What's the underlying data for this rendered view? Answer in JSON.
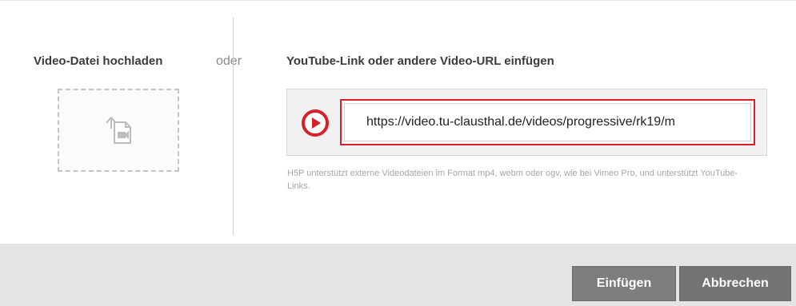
{
  "upload": {
    "label": "Video-Datei hochladen",
    "icon": "upload-video-icon"
  },
  "separator": {
    "label": "oder"
  },
  "url": {
    "label": "YouTube-Link oder andere Video-URL einfügen",
    "value": "https://video.tu-clausthal.de/videos/progressive/rk19/m",
    "play_icon": "play-icon",
    "help_text": "H5P unterstützt externe Videodateien im Format mp4, webm oder ogv, wie bei Vimeo Pro, und unterstützt YouTube-Links."
  },
  "footer": {
    "insert_label": "Einfügen",
    "cancel_label": "Abbrechen"
  },
  "colors": {
    "accent_red": "#d9202a",
    "button_gray": "#7a7a7a",
    "footer_bg": "#e4e4e4"
  }
}
